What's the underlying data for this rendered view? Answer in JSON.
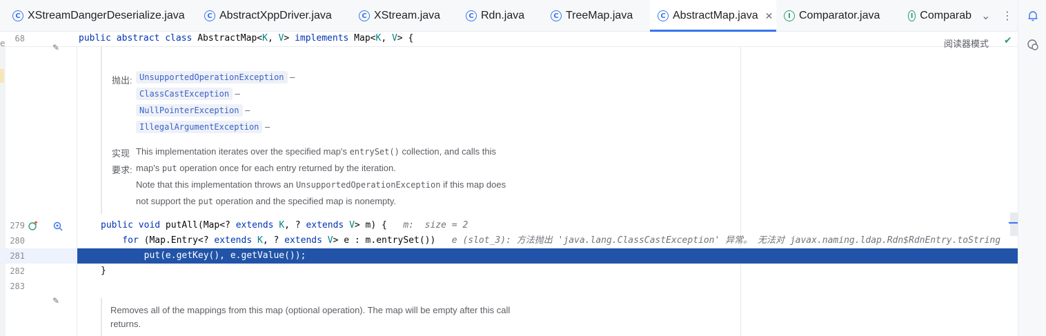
{
  "tabs": [
    {
      "label": "XStreamDangerDeserialize.java",
      "kind": "class"
    },
    {
      "label": "AbstractXppDriver.java",
      "kind": "class"
    },
    {
      "label": "XStream.java",
      "kind": "class"
    },
    {
      "label": "Rdn.java",
      "kind": "class"
    },
    {
      "label": "TreeMap.java",
      "kind": "class"
    },
    {
      "label": "AbstractMap.java",
      "kind": "class",
      "active": true
    },
    {
      "label": "Comparator.java",
      "kind": "interface"
    },
    {
      "label": "Comparab",
      "kind": "interface"
    }
  ],
  "tab_tools": {
    "more_icon": "chevron-down-icon",
    "menu_icon": "more-vertical-icon"
  },
  "right_strip": {
    "notifications_icon": "bell-icon",
    "ai_icon": "ai-chat-icon"
  },
  "reader_mode": "阅读器模式",
  "sticky": {
    "line": "68",
    "code": [
      {
        "t": "public abstract class ",
        "c": "kw"
      },
      {
        "t": "AbstractMap<",
        "c": "plain"
      },
      {
        "t": "K",
        "c": "typ"
      },
      {
        "t": ", ",
        "c": "plain"
      },
      {
        "t": "V",
        "c": "typ"
      },
      {
        "t": "> ",
        "c": "plain"
      },
      {
        "t": "implements ",
        "c": "kw"
      },
      {
        "t": "Map<",
        "c": "plain"
      },
      {
        "t": "K",
        "c": "typ"
      },
      {
        "t": ", ",
        "c": "plain"
      },
      {
        "t": "V",
        "c": "typ"
      },
      {
        "t": "> {",
        "c": "plain"
      }
    ]
  },
  "doc1": {
    "throws_label": "抛出:",
    "exceptions": [
      "UnsupportedOperationException",
      "ClassCastException",
      "NullPointerException",
      "IllegalArgumentException"
    ],
    "dash": "–",
    "impl_label_1": "实现",
    "impl_label_2": "要求:",
    "impl_lines": [
      [
        "This implementation iterates over the specified map's ",
        "entrySet()",
        " collection, and calls this"
      ],
      [
        "map's ",
        "put",
        " operation once for each entry returned by the iteration."
      ],
      [
        "Note that this implementation throws an ",
        "UnsupportedOperationException",
        " if this map does"
      ],
      [
        "not support the ",
        "put",
        " operation and the specified map is nonempty."
      ]
    ]
  },
  "code_lines": [
    {
      "num": "279",
      "parts": [
        {
          "t": "public void ",
          "c": "kw"
        },
        {
          "t": "putAll",
          "c": "plain"
        },
        {
          "t": "(Map<? ",
          "c": "plain"
        },
        {
          "t": "extends ",
          "c": "kw"
        },
        {
          "t": "K",
          "c": "typ"
        },
        {
          "t": ", ? ",
          "c": "plain"
        },
        {
          "t": "extends ",
          "c": "kw"
        },
        {
          "t": "V",
          "c": "typ"
        },
        {
          "t": "> m) {",
          "c": "plain"
        },
        {
          "t": "   m:  size = 2",
          "c": "hint"
        }
      ]
    },
    {
      "num": "280",
      "parts": [
        {
          "t": "    for ",
          "c": "kw"
        },
        {
          "t": "(Map.Entry<? ",
          "c": "plain"
        },
        {
          "t": "extends ",
          "c": "kw"
        },
        {
          "t": "K",
          "c": "typ"
        },
        {
          "t": ", ? ",
          "c": "plain"
        },
        {
          "t": "extends ",
          "c": "kw"
        },
        {
          "t": "V",
          "c": "typ"
        },
        {
          "t": "> e : m.entrySet())",
          "c": "plain"
        },
        {
          "t": "   e (slot_3): 方法抛出 'java.lang.ClassCastException' 异常。 无法对 javax.naming.ldap.Rdn$RdnEntry.toString",
          "c": "hint"
        }
      ]
    },
    {
      "num": "281",
      "parts": [
        {
          "t": "        put(e.getKey(), e.getValue());",
          "c": "plain"
        }
      ],
      "selected": true
    },
    {
      "num": "282",
      "parts": [
        {
          "t": "}",
          "c": "plain"
        }
      ]
    },
    {
      "num": "283",
      "parts": []
    }
  ],
  "doc2": {
    "line1": "Removes all of the mappings from this map (optional operation). The map will be empty after this call",
    "line2": "returns."
  },
  "gutter_icons": {
    "impl_icon": "implements-marker-icon",
    "debug_icon": "search-usage-icon",
    "edit_icon": "pencil-icon"
  },
  "colors": {
    "selection": "#2154a8",
    "keyword": "#0033b3",
    "type_param": "#008080",
    "accent": "#3574f0"
  }
}
